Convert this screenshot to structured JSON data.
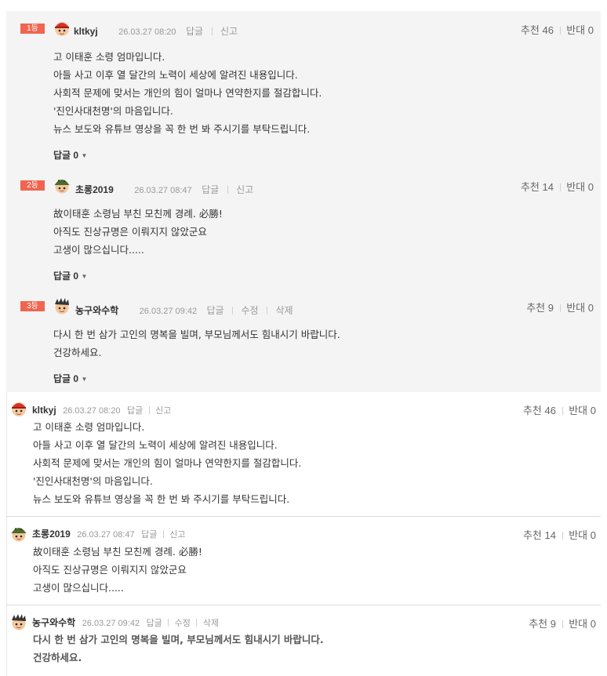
{
  "best_comments": [
    {
      "rank": "1등",
      "nickname": "kltkyj",
      "date": "26.03.27 08:20",
      "actions": [
        "답글",
        "신고"
      ],
      "recommend_label": "추천",
      "recommend": "46",
      "oppose_label": "반대",
      "oppose": "0",
      "lines": [
        "고 이태훈 소령 엄마입니다.",
        "아들 사고 이후 열 달간의 노력이 세상에 알려진 내용입니다.",
        "사회적 문제에 맞서는 개인의 힘이 얼마나 연약한지를 절감합니다.",
        "'진인사대천명'의 마음입니다.",
        "뉴스 보도와 유튜브 영상을 꼭 한 번 봐 주시기를 부탁드립니다."
      ],
      "reply_label": "답글 0"
    },
    {
      "rank": "2등",
      "nickname": "초롱2019",
      "date": "26.03.27 08:47",
      "actions": [
        "답글",
        "신고"
      ],
      "recommend_label": "추천",
      "recommend": "14",
      "oppose_label": "반대",
      "oppose": "0",
      "lines": [
        "故이태훈 소령님 부친 모친께 경례. 必勝!",
        "아직도 진상규명은 이뤄지지 않았군요",
        "고생이 많으십니다....."
      ],
      "reply_label": "답글 0"
    },
    {
      "rank": "3등",
      "nickname": "농구와수학",
      "date": "26.03.27 09:42",
      "actions": [
        "답글",
        "수정",
        "삭제"
      ],
      "recommend_label": "추천",
      "recommend": "9",
      "oppose_label": "반대",
      "oppose": "0",
      "lines": [
        "다시 한 번 삼가 고인의 명복을 빌며, 부모님께서도 힘내시기 바랍니다.",
        "건강하세요."
      ],
      "reply_label": "답글 0"
    }
  ],
  "comments": [
    {
      "nickname": "kltkyj",
      "date": "26.03.27 08:20",
      "actions": [
        "답글",
        "신고"
      ],
      "recommend_label": "추천",
      "recommend": "46",
      "oppose_label": "반대",
      "oppose": "0",
      "lines": [
        "고 이태훈 소령 엄마입니다.",
        "아들 사고 이후 열 달간의 노력이 세상에 알려진 내용입니다.",
        "사회적 문제에 맞서는 개인의 힘이 얼마나 연약한지를 절감합니다.",
        "'진인사대천명'의 마음입니다.",
        "뉴스 보도와 유튜브 영상을 꼭 한 번 봐 주시기를 부탁드립니다."
      ]
    },
    {
      "nickname": "초롱2019",
      "date": "26.03.27 08:47",
      "actions": [
        "답글",
        "신고"
      ],
      "recommend_label": "추천",
      "recommend": "14",
      "oppose_label": "반대",
      "oppose": "0",
      "lines": [
        "故이태훈 소령님 부친 모친께 경례. 必勝!",
        "아직도 진상규명은 이뤄지지 않았군요",
        "고생이 많으십니다....."
      ]
    },
    {
      "nickname": "농구와수학",
      "date": "26.03.27 09:42",
      "actions": [
        "답글",
        "수정",
        "삭제"
      ],
      "recommend_label": "추천",
      "recommend": "9",
      "oppose_label": "반대",
      "oppose": "0",
      "lines": [
        "다시 한 번 삼가 고인의 명복을 빌며, 부모님께서도 힘내시기 바랍니다.",
        "건강하세요."
      ]
    }
  ],
  "colors": {
    "rank_badge": "#f0654f",
    "best_bg": "#f4f4f4",
    "meta_gray": "#999999"
  },
  "icons": [
    "avatar-red-cap-icon",
    "avatar-helmet-icon",
    "avatar-spiky-hair-icon",
    "caret-down-icon"
  ]
}
